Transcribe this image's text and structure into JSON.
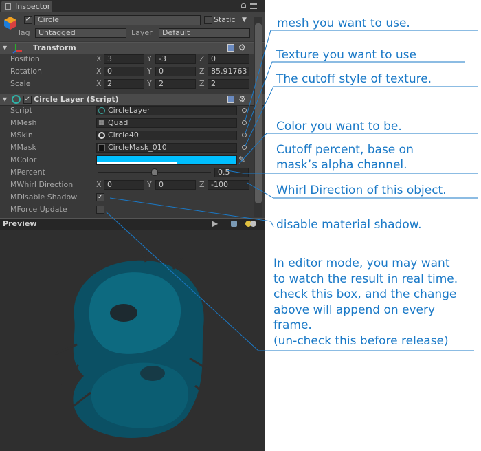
{
  "inspector": {
    "tab_label": "Inspector",
    "object_name": "Circle",
    "static_label": "Static",
    "tag_label": "Tag",
    "tag_value": "Untagged",
    "layer_label": "Layer",
    "layer_value": "Default"
  },
  "transform": {
    "title": "Transform",
    "rows": [
      {
        "label": "Position",
        "x": "3",
        "y": "-3",
        "z": "0"
      },
      {
        "label": "Rotation",
        "x": "0",
        "y": "0",
        "z": "85.91763"
      },
      {
        "label": "Scale",
        "x": "2",
        "y": "2",
        "z": "2"
      }
    ]
  },
  "axes": {
    "x": "X",
    "y": "Y",
    "z": "Z"
  },
  "circle_layer": {
    "title": "Circle Layer (Script)",
    "script_label": "Script",
    "script_value": "CircleLayer",
    "mesh_label": "MMesh",
    "mesh_value": "Quad",
    "skin_label": "MSkin",
    "skin_value": "Circle40",
    "mask_label": "MMask",
    "mask_value": "CircleMask_010",
    "color_label": "MColor",
    "color_value": "#00bfff",
    "percent_label": "MPercent",
    "percent_value": "0.5",
    "percent_fraction": 0.5,
    "whirl_label": "MWhirl Direction",
    "whirl_x": "0",
    "whirl_y": "0",
    "whirl_z": "-100",
    "shadow_label": "MDisable Shadow",
    "shadow_checked": true,
    "force_label": "MForce Update",
    "force_checked": false
  },
  "preview": {
    "label": "Preview"
  },
  "icons": [
    "cube-icon",
    "transform-axes-icon",
    "script-icon",
    "book-icon",
    "gear-icon",
    "lock-icon",
    "menu-icon",
    "play-icon",
    "sphere-icon",
    "object-picker-icon",
    "eyedropper-icon",
    "foldout-arrow-icon"
  ],
  "annotations": {
    "mesh": "mesh you want to use.",
    "texture": "Texture you want  to use",
    "cutoff_style": "The cutoff style of texture.",
    "color": "Color you want to be.",
    "percent_line1": "Cutoff percent, base on",
    "percent_line2": "mask’s alpha channel.",
    "whirl": "Whirl Direction of this object.",
    "shadow": "disable material shadow.",
    "force_lines": [
      "In editor mode, you may want",
      "to watch the result in real time.",
      "check this box, and the change",
      "above will append on every",
      "frame.",
      "(un-check this before release)"
    ]
  }
}
